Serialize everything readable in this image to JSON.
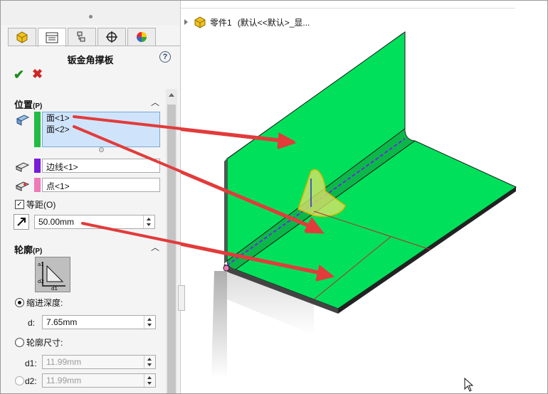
{
  "feature_title": "钣金角撑板",
  "tabs": [
    "feature-manager-icon",
    "property-manager-icon",
    "configuration-manager-icon",
    "dimxpert-icon",
    "display-manager-icon"
  ],
  "position": {
    "header": "位置",
    "header_suffix": "(P)",
    "faces": [
      "面<1>",
      "面<2>"
    ],
    "edge": "边线<1>",
    "point": "点<1>",
    "offset_label": "等距(O)",
    "offset_checked": true,
    "offset_value": "50.00mm",
    "face_color": "#22bb44",
    "edge_color": "#7a1bd8",
    "point_color": "#ef7ab8"
  },
  "profile": {
    "header": "轮廓",
    "header_suffix": "(P)",
    "indent_label": "缩进深度:",
    "d_label": "d:",
    "d_value": "7.65mm",
    "size_label": "轮廓尺寸:",
    "d1_label": "d1:",
    "d1_value": "11.99mm",
    "d2_label": "d2:",
    "d2_value": "11.99mm"
  },
  "breadcrumb": {
    "part": "零件1",
    "config": "(默认<<默认>_显..."
  },
  "model_color": "#00e05a"
}
